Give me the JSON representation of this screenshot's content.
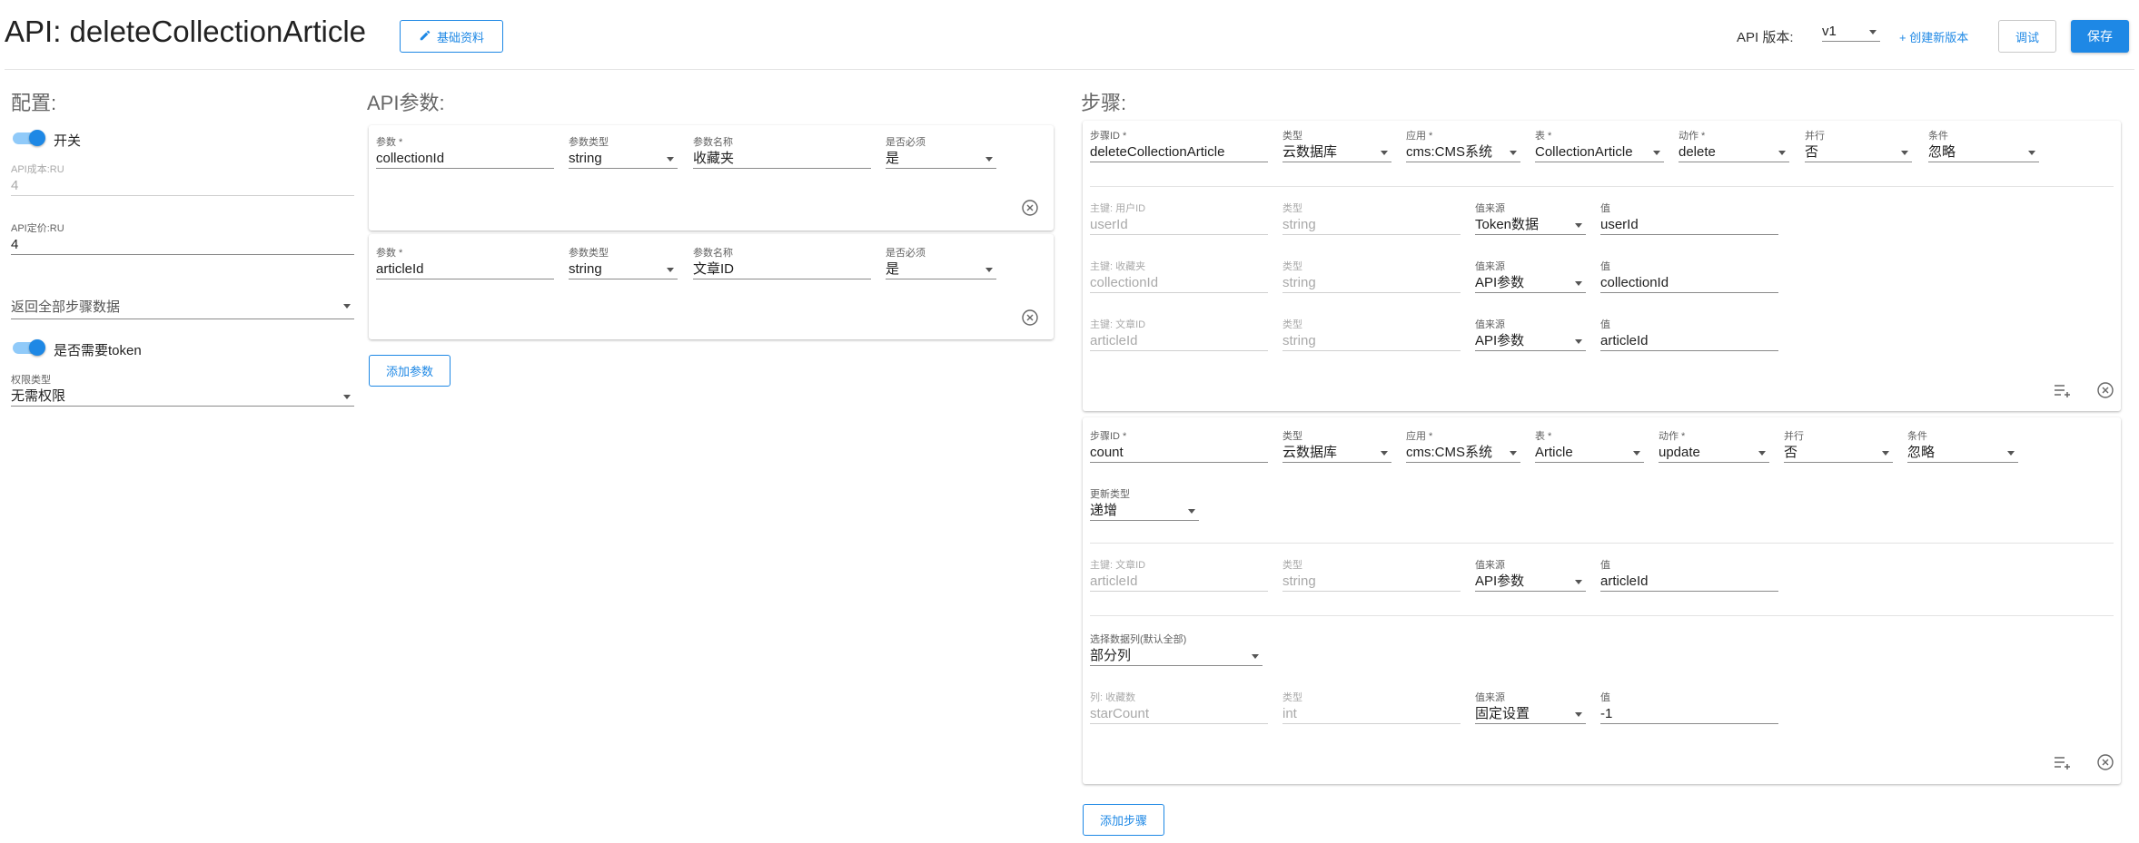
{
  "header": {
    "title": "API: deleteCollectionArticle",
    "basic_info_button": "基础资料",
    "api_version_label": "API 版本:",
    "api_version_value": "v1",
    "create_version_link": "+ 创建新版本",
    "debug_button": "调试",
    "save_button": "保存"
  },
  "config": {
    "title": "配置:",
    "switch_label": "开关",
    "api_cost_label": "API成本:RU",
    "api_cost_value": "4",
    "api_price_label": "API定价:RU",
    "api_price_value": "4",
    "return_select": "返回全部步骤数据",
    "token_label": "是否需要token",
    "permission_type_label": "权限类型",
    "permission_type_value": "无需权限"
  },
  "params": {
    "title": "API参数:",
    "add_button": "添加参数",
    "columns": {
      "param": "参数",
      "type": "参数类型",
      "name": "参数名称",
      "required": "是否必须"
    },
    "items": [
      {
        "param": "collectionId",
        "type": "string",
        "name": "收藏夹",
        "required": "是"
      },
      {
        "param": "articleId",
        "type": "string",
        "name": "文章ID",
        "required": "是"
      }
    ]
  },
  "steps": {
    "title": "步骤:",
    "add_button": "添加步骤",
    "labels": {
      "step_id": "步骤ID",
      "type": "类型",
      "app": "应用",
      "table": "表",
      "action": "动作",
      "parallel": "并行",
      "condition": "条件",
      "value_source": "值来源",
      "value": "值",
      "update_type": "更新类型",
      "select_columns": "选择数据列(默认全部)"
    },
    "step1": {
      "step_id": "deleteCollectionArticle",
      "type": "云数据库",
      "app": "cms:CMS系统",
      "table": "CollectionArticle",
      "action": "delete",
      "parallel": "否",
      "condition": "忽略",
      "keys": [
        {
          "label": "主键: 用户ID",
          "field": "userId",
          "ftype": "string",
          "source": "Token数据",
          "value": "userId"
        },
        {
          "label": "主键: 收藏夹",
          "field": "collectionId",
          "ftype": "string",
          "source": "API参数",
          "value": "collectionId"
        },
        {
          "label": "主键: 文章ID",
          "field": "articleId",
          "ftype": "string",
          "source": "API参数",
          "value": "articleId"
        }
      ]
    },
    "step2": {
      "step_id": "count",
      "type": "云数据库",
      "app": "cms:CMS系统",
      "table": "Article",
      "action": "update",
      "parallel": "否",
      "condition": "忽略",
      "update_type": "递增",
      "key": {
        "label": "主键: 文章ID",
        "field": "articleId",
        "ftype": "string",
        "source": "API参数",
        "value": "articleId"
      },
      "columns_select": "部分列",
      "column": {
        "label": "列: 收藏数",
        "field": "starCount",
        "ftype": "int",
        "source": "固定设置",
        "value": "-1"
      }
    }
  }
}
